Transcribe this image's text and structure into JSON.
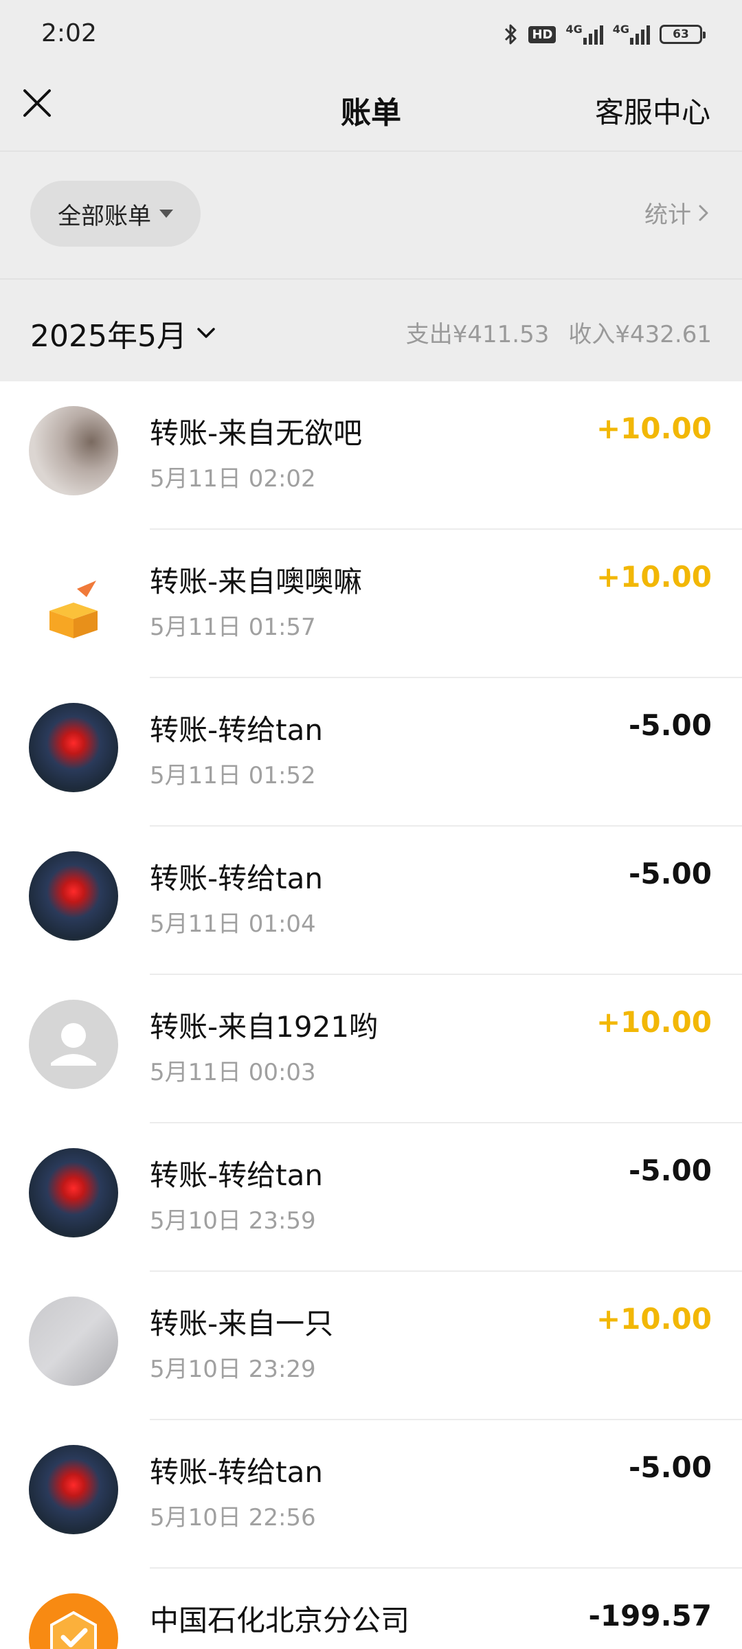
{
  "status_bar": {
    "time": "2:02",
    "hd_label": "HD",
    "network_1": "4G",
    "network_2": "4G",
    "battery": "63"
  },
  "nav": {
    "title": "账单",
    "service_label": "客服中心"
  },
  "filter": {
    "selected": "全部账单",
    "stats_label": "统计"
  },
  "month": {
    "label": "2025年5月",
    "expense": "支出¥411.53",
    "income": "收入¥432.61"
  },
  "transactions": [
    {
      "title": "转账-来自无欲吧",
      "date": "5月11日 02:02",
      "amount": "+10.00",
      "type": "income",
      "avatar": "photo-avatar"
    },
    {
      "title": "转账-来自噢噢嘛",
      "date": "5月11日 01:57",
      "amount": "+10.00",
      "type": "income",
      "avatar": "gift-box-avatar"
    },
    {
      "title": "转账-转给tan",
      "date": "5月11日 01:52",
      "amount": "-5.00",
      "type": "expense",
      "avatar": "flower-avatar"
    },
    {
      "title": "转账-转给tan",
      "date": "5月11日 01:04",
      "amount": "-5.00",
      "type": "expense",
      "avatar": "flower-avatar"
    },
    {
      "title": "转账-来自1921哟",
      "date": "5月11日 00:03",
      "amount": "+10.00",
      "type": "income",
      "avatar": "default-user-avatar"
    },
    {
      "title": "转账-转给tan",
      "date": "5月10日 23:59",
      "amount": "-5.00",
      "type": "expense",
      "avatar": "flower-avatar"
    },
    {
      "title": "转账-来自一只",
      "date": "5月10日 23:29",
      "amount": "+10.00",
      "type": "income",
      "avatar": "photo-avatar"
    },
    {
      "title": "转账-转给tan",
      "date": "5月10日 22:56",
      "amount": "-5.00",
      "type": "expense",
      "avatar": "flower-avatar"
    },
    {
      "title": "中国石化北京分公司",
      "date": "",
      "amount": "-199.57",
      "type": "expense",
      "avatar": "sinopec-logo"
    }
  ],
  "colors": {
    "income": "#f2b705",
    "expense": "#111111",
    "background": "#ededed"
  }
}
